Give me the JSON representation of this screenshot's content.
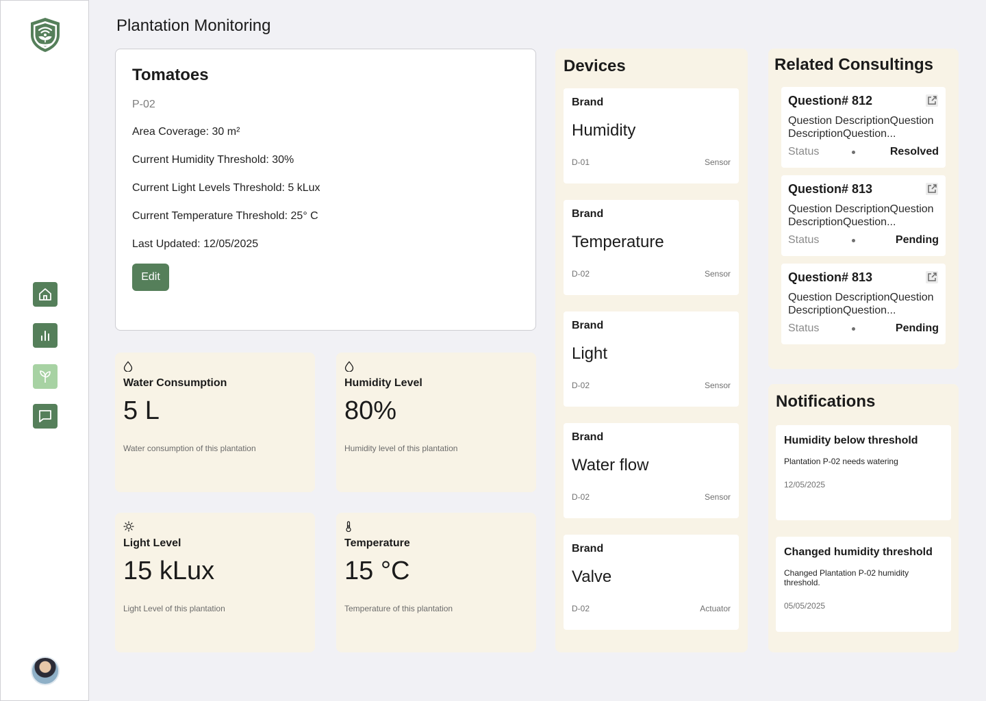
{
  "page": {
    "title": "Plantation Monitoring"
  },
  "sidebar": {
    "logo": "plant-wifi-shield-logo",
    "nav": [
      {
        "name": "home",
        "icon": "home-icon",
        "active": false
      },
      {
        "name": "analytics",
        "icon": "bar-chart-icon",
        "active": false
      },
      {
        "name": "plantations",
        "icon": "sprout-icon",
        "active": true
      },
      {
        "name": "messages",
        "icon": "chat-icon",
        "active": false
      }
    ],
    "avatar": "user-avatar"
  },
  "plantation": {
    "name": "Tomatoes",
    "id": "P-02",
    "area": "Area Coverage: 30 m²",
    "humidity_threshold": "Current Humidity Threshold: 30%",
    "light_threshold": "Current Light Levels Threshold: 5 kLux",
    "temperature_threshold": "Current Temperature Threshold: 25° C",
    "last_updated": "Last Updated: 12/05/2025",
    "edit_label": "Edit"
  },
  "metrics": [
    {
      "icon": "droplet-icon",
      "label": "Water Consumption",
      "value": "5 L",
      "desc": "Water consumption of this plantation"
    },
    {
      "icon": "droplet-icon",
      "label": "Humidity Level",
      "value": "80%",
      "desc": "Humidity level of this plantation"
    },
    {
      "icon": "sun-icon",
      "label": "Light Level",
      "value": "15 kLux",
      "desc": "Light Level of this plantation"
    },
    {
      "icon": "thermometer-icon",
      "label": "Temperature",
      "value": "15 °C",
      "desc": "Temperature of this plantation"
    }
  ],
  "devices": {
    "title": "Devices",
    "items": [
      {
        "brand": "Brand",
        "name": "Humidity",
        "id": "D-01",
        "type": "Sensor"
      },
      {
        "brand": "Brand",
        "name": "Temperature",
        "id": "D-02",
        "type": "Sensor"
      },
      {
        "brand": "Brand",
        "name": "Light",
        "id": "D-02",
        "type": "Sensor"
      },
      {
        "brand": "Brand",
        "name": "Water flow",
        "id": "D-02",
        "type": "Sensor"
      },
      {
        "brand": "Brand",
        "name": "Valve",
        "id": "D-02",
        "type": "Actuator"
      }
    ]
  },
  "consultings": {
    "title": "Related Consultings",
    "items": [
      {
        "title": "Question# 812",
        "desc_line1": "Question DescriptionQuestion",
        "desc_line2": "DescriptionQuestion...",
        "status_label": "Status",
        "status": "Resolved"
      },
      {
        "title": "Question# 813",
        "desc_line1": "Question DescriptionQuestion",
        "desc_line2": "DescriptionQuestion...",
        "status_label": "Status",
        "status": "Pending"
      },
      {
        "title": "Question# 813",
        "desc_line1": "Question DescriptionQuestion",
        "desc_line2": "DescriptionQuestion...",
        "status_label": "Status",
        "status": "Pending"
      }
    ]
  },
  "notifications": {
    "title": "Notifications",
    "items": [
      {
        "title": "Humidity below threshold",
        "message": "Plantation P-02 needs watering",
        "date": "12/05/2025"
      },
      {
        "title": "Changed humidity threshold",
        "message": "Changed Plantation P-02 humidity threshold.",
        "date": "05/05/2025"
      }
    ]
  },
  "colors": {
    "primary_green": "#557f5a",
    "light_green": "#a7d2a3",
    "card_cream": "#f8f3e6",
    "background": "#f1f1f5"
  }
}
